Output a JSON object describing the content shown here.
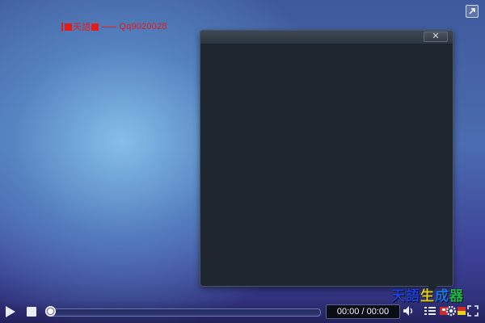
{
  "watermark": {
    "text_1": "天語",
    "text_2": "Qq9020028"
  },
  "panel": {
    "close_label": "✕"
  },
  "logo": {
    "chars": [
      "天",
      "語",
      "生",
      "成",
      "器"
    ],
    "colors": [
      "#1f3fd6",
      "#1f3fd6",
      "#e8d014",
      "#1f73e0",
      "#20b548"
    ]
  },
  "controls": {
    "time_display": "00:00 / 00:00",
    "progress": 0
  },
  "icons": {
    "top_right": "expand-icon",
    "play": "play-icon",
    "stop": "stop-icon",
    "volume": "volume-icon",
    "playlist": "playlist-icon",
    "settings": "gear-icon",
    "fullscreen": "fullscreen-icon"
  },
  "colors": {
    "watermark": "#e31b1b",
    "panel_bg": "#1e2730"
  }
}
